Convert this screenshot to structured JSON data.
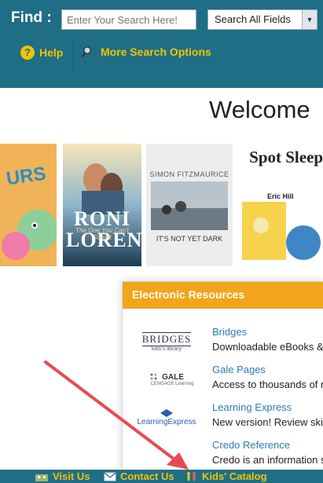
{
  "search": {
    "find_label": "Find :",
    "placeholder": "Enter Your Search Here!",
    "scope_selected": "Search All Fields"
  },
  "toolbar": {
    "help_label": "Help",
    "more_options_label": "More Search Options"
  },
  "welcome": {
    "heading": "Welcome"
  },
  "books": [
    {
      "title_text": "URS"
    },
    {
      "author": "RONI LOREN",
      "title": "The One You Can't Forget"
    },
    {
      "author": "SIMON FITZMAURICE",
      "title": "IT'S NOT YET DARK"
    },
    {
      "title": "Spot Sleeps O",
      "author": "Eric Hill"
    }
  ],
  "resources": {
    "header": "Electronic Resources",
    "items": [
      {
        "logo_text": "BRIDGES",
        "logo_sub": "kids's library",
        "name": "Bridges",
        "description": "Downloadable eBooks & a"
      },
      {
        "logo_text": "GALE",
        "logo_sub": "CENGAGE Learning",
        "name": "Gale Pages",
        "description": "Access to thousands of re"
      },
      {
        "logo_text": "LearningExpress",
        "logo_sub": "",
        "name": "Learning Express",
        "description": "New version! Review skil"
      },
      {
        "logo_text": "",
        "logo_sub": "",
        "name": "Credo Reference",
        "description": "Credo is an information sl"
      }
    ]
  },
  "footer": {
    "visit_label": "Visit Us",
    "contact_label": "Contact Us",
    "kids_label": "Kids' Catalog"
  },
  "colors": {
    "bar": "#1f6e86",
    "accent_yellow": "#f2c300",
    "resources_header": "#f2a51a",
    "link_blue": "#2a7db0",
    "annotation_arrow": "#e84a55"
  }
}
